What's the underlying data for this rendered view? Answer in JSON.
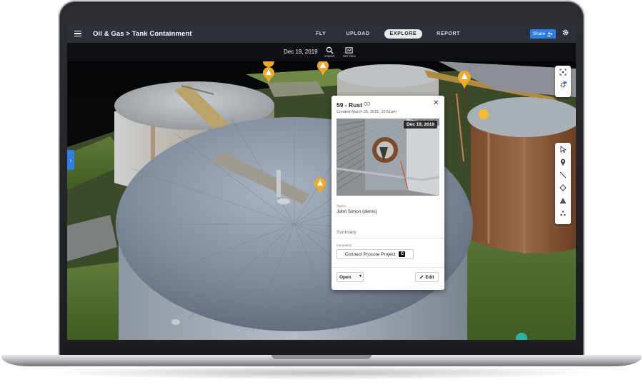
{
  "app": {
    "breadcrumb": "Oil & Gas > Tank Containment",
    "nav": {
      "fly": "FLY",
      "upload": "UPLOAD",
      "explore": "EXPLORE",
      "report": "REPORT",
      "active": "EXPLORE"
    },
    "share_label": "Share",
    "accent_color": "#2f7ee6"
  },
  "datebar": {
    "date": "Dec 19, 2019",
    "inspect_label": "Inspect",
    "set_view_label": "Set View"
  },
  "annotation": {
    "title": "59 - Rust",
    "created": "Created March 25, 2021, 10:51am",
    "photo_date": "Dec 19, 2019",
    "owner_label": "Owner",
    "owner": "John Simon (demo)",
    "summary_placeholder": "Summary",
    "integration_label": "Integration",
    "procore_button": "Connect Procore Project",
    "open_button": "Open",
    "edit_button": "Edit",
    "pin_color": "#f0a92a"
  },
  "right_toolbar": {
    "top_icons": [
      "focus-icon",
      "layers-settings-icon"
    ],
    "tools": [
      "select-arrow-icon",
      "location-pin-icon",
      "line-measure-icon",
      "area-polygon-icon",
      "volume-icon",
      "point-cloud-icon"
    ]
  }
}
